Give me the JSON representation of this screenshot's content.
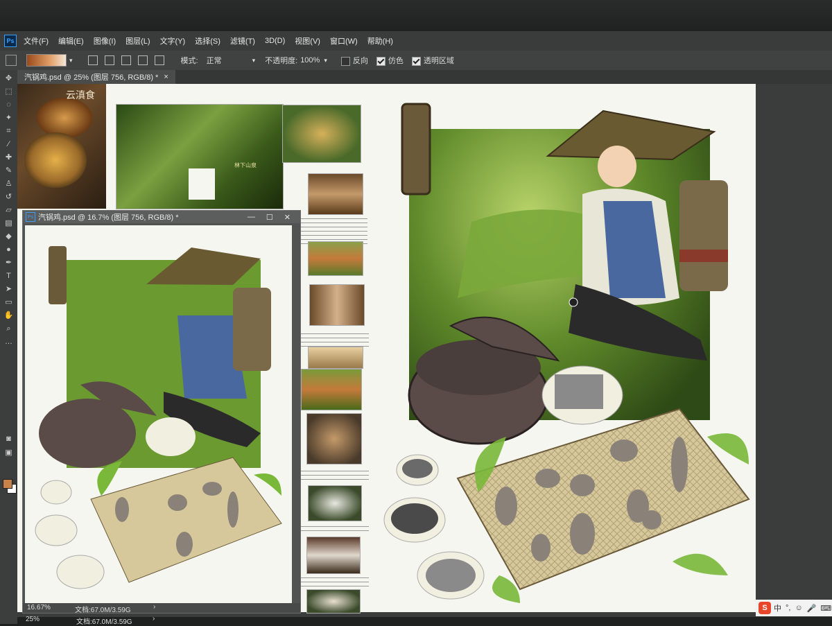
{
  "menubar": {
    "items": [
      "文件(F)",
      "编辑(E)",
      "图像(I)",
      "图层(L)",
      "文字(Y)",
      "选择(S)",
      "滤镜(T)",
      "3D(D)",
      "视图(V)",
      "窗口(W)",
      "帮助(H)"
    ]
  },
  "options": {
    "mode_label": "模式:",
    "mode_value": "正常",
    "opacity_label": "不透明度:",
    "opacity_value": "100%",
    "reverse_label": "反向",
    "dither_label": "仿色",
    "transparency_label": "透明区域",
    "reverse_checked": false,
    "dither_checked": true,
    "transparency_checked": true
  },
  "main_tab": {
    "title": "汽锅鸡.psd @ 25% (图层 756, RGB/8) *",
    "close": "×"
  },
  "sub_window": {
    "title": "汽锅鸡.psd @ 16.7% (图层 756, RGB/8) *",
    "zoom": "16.67%",
    "doc_info": "文档:67.0M/3.59G"
  },
  "status": {
    "zoom": "25%",
    "doc_info": "文档:67.0M/3.59G"
  },
  "ref_logo": "云滇食",
  "photo_caption": "林下山泉",
  "ime": {
    "mode": "中"
  },
  "colors": {
    "foreground": "#c8824a",
    "background": "#ffffff",
    "accent": "#3aa0ff"
  }
}
